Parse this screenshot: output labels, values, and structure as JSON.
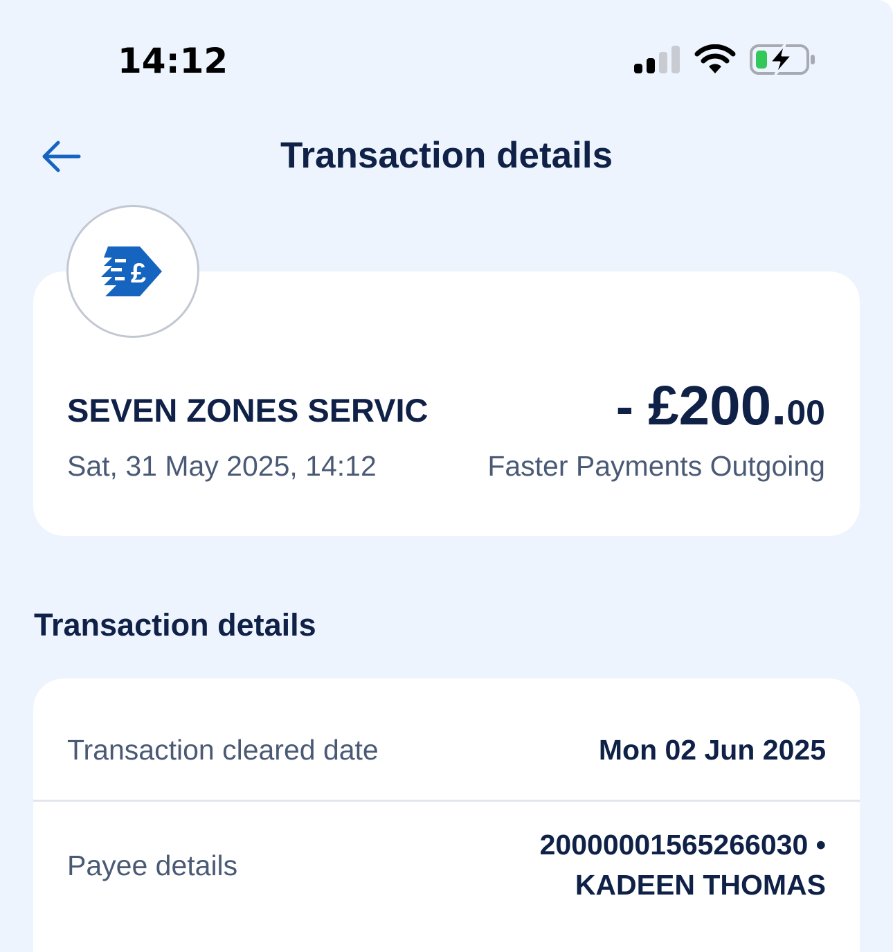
{
  "status_bar": {
    "time": "14:12"
  },
  "header": {
    "title": "Transaction details",
    "back_icon": "arrow-left-icon"
  },
  "summary": {
    "merchant_icon": "faster-payment-pound-icon",
    "merchant_name": "SEVEN ZONES SERVIC",
    "datetime": "Sat, 31 May 2025, 14:12",
    "amount_sign": "- ",
    "amount_main": "£200.",
    "amount_pence": "00",
    "transaction_type": "Faster Payments Outgoing"
  },
  "details": {
    "heading": "Transaction details",
    "rows": [
      {
        "label": "Transaction cleared date",
        "value": "Mon 02 Jun 2025"
      },
      {
        "label": "Payee details",
        "value_line1": "20000001565266030 •",
        "value_line2": "KADEEN THOMAS"
      }
    ]
  },
  "colors": {
    "background": "#edf4fd",
    "card": "#ffffff",
    "primary_text": "#0f2147",
    "secondary_text": "#4a5a75",
    "accent": "#1565c0",
    "battery_fill": "#34c759"
  }
}
